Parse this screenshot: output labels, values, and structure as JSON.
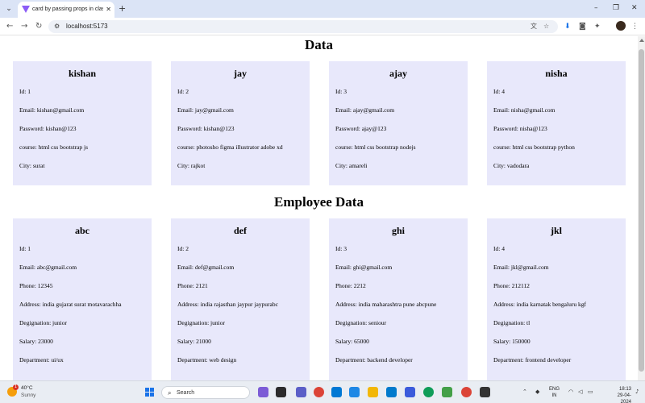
{
  "browser": {
    "tab_title": "card by passing props in class c",
    "url": "localhost:5173"
  },
  "sections": [
    {
      "title": "Data",
      "cards": [
        {
          "name": "kishan",
          "lines": [
            "Id: 1",
            "Email: kishan@gmail.com",
            "Password: kishan@123",
            "course: html css bootstrap js",
            "City: surat"
          ]
        },
        {
          "name": "jay",
          "lines": [
            "Id: 2",
            "Email: jay@gmail.com",
            "Password: kishan@123",
            "course: photosho figma illustrator adobe xd",
            "City: rajkot"
          ]
        },
        {
          "name": "ajay",
          "lines": [
            "Id: 3",
            "Email: ajay@gmail.com",
            "Password: ajay@123",
            "course: html css bootstrap nodejs",
            "City: amareli"
          ]
        },
        {
          "name": "nisha",
          "lines": [
            "Id: 4",
            "Email: nisha@gmail.com",
            "Password: nisha@123",
            "course: html css bootstrap python",
            "City: vadodara"
          ]
        }
      ]
    },
    {
      "title": "Employee Data",
      "cards": [
        {
          "name": "abc",
          "lines": [
            "Id: 1",
            "Email: abc@gmail.com",
            "Phone: 12345",
            "Address: india gujarat surat motavarachha",
            "Degignation: junior",
            "Salary: 23000",
            "Department: ui/ux"
          ]
        },
        {
          "name": "def",
          "lines": [
            "Id: 2",
            "Email: def@gmail.com",
            "Phone: 2121",
            "Address: india rajasthan jaypur jaypurabc",
            "Degignation: junior",
            "Salary: 21000",
            "Department: web design"
          ]
        },
        {
          "name": "ghi",
          "lines": [
            "Id: 3",
            "Email: ghi@gmail.com",
            "Phone: 2212",
            "Address: india maharashtra pune abcpune",
            "Degignation: seniour",
            "Salary: 65000",
            "Department: backend developer"
          ]
        },
        {
          "name": "jkl",
          "lines": [
            "Id: 4",
            "Email: jkl@gmail.com",
            "Phone: 212112",
            "Address: india karnatak bengaluru kgf",
            "Degignation: tl",
            "Salary: 150000",
            "Department: frontend developer"
          ]
        }
      ]
    }
  ],
  "taskbar": {
    "weather_temp": "40°C",
    "weather_desc": "Sunny",
    "weather_badge": "1",
    "search_placeholder": "Search",
    "lang_1": "ENG",
    "lang_2": "IN",
    "time": "18:13",
    "date": "29-04-2024"
  },
  "colors": {
    "card_bg": "#e8e8fb",
    "tabstrip_bg": "#dbe4f6"
  }
}
